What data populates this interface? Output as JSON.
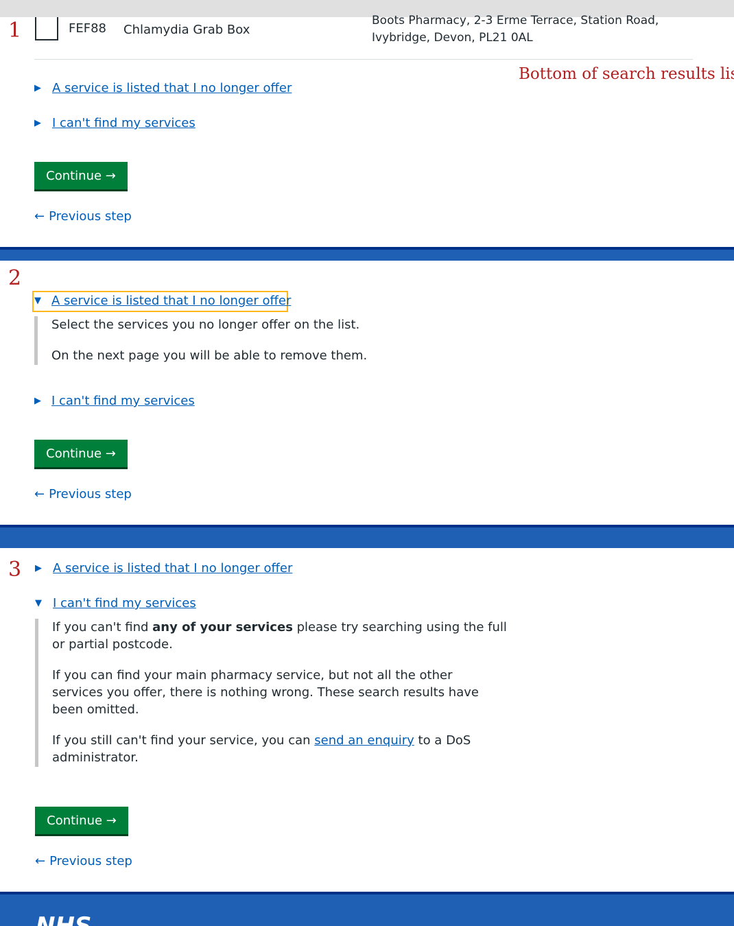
{
  "annotations": {
    "step1": "1",
    "step2": "2",
    "step3": "3",
    "bottom_note": "Bottom of search results list"
  },
  "result_row": {
    "code": "FEF88",
    "service_name": "Chlamydia Grab Box",
    "address_line1": "Boots Pharmacy, 2-3 Erme Terrace, Station Road,",
    "address_line2": "Ivybridge, Devon, PL21 0AL"
  },
  "details": {
    "no_longer_offer": "A service is listed that I no longer offer",
    "cant_find": "I can't find my services"
  },
  "panel_no_longer_offer": {
    "p1": "Select the services you no longer offer on the list.",
    "p2": "On the next page you will be able to remove them."
  },
  "panel_cant_find": {
    "p1_before": "If you can't find ",
    "p1_bold": "any of your services",
    "p1_after": " please try searching using the full",
    "p1_line2": "or partial postcode.",
    "p2_line1": "If you can find your main pharmacy service, but not all the other",
    "p2_line2": "services you offer, there is nothing wrong. These search results have",
    "p2_line3": "been omitted.",
    "p3_before": "If you still can't find your service, you can ",
    "p3_link": "send an enquiry",
    "p3_after": " to a DoS",
    "p3_line2": "administrator."
  },
  "buttons": {
    "continue": "Continue →",
    "previous": "Previous step",
    "previous_arrow": "←"
  },
  "footer": {
    "logo": "NHS"
  },
  "colors": {
    "link": "#005eb8",
    "button": "#007f3b",
    "focus": "#ffb81c",
    "band": "#1f5fb4",
    "annotation": "#b21f1f"
  }
}
